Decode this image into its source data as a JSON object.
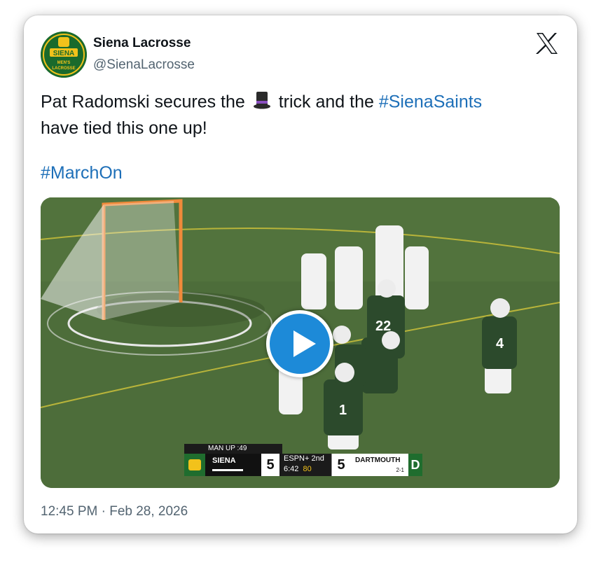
{
  "author": {
    "name": "Siena Lacrosse",
    "handle": "@SienaLacrosse",
    "avatar_text": "SIENA MEN'S LACROSSE"
  },
  "platform_icon": "x-logo-icon",
  "tweet": {
    "text_part1": "Pat Radomski secures the",
    "emoji": "top-hat-icon",
    "text_part2": "trick and the",
    "hashtag1": "#SienaSaints",
    "text_part3": "have tied this one up!",
    "hashtag2": "#MarchOn"
  },
  "media": {
    "type": "video",
    "play_icon": "play-icon",
    "scorebug": {
      "man_up": "MAN UP  :49",
      "home_team": "SIENA",
      "home_score": "5",
      "network": "ESPN+",
      "period": "2nd",
      "clock": "6:42",
      "shot_clock": "80",
      "away_score": "5",
      "away_team": "DARTMOUTH",
      "away_record": "2-1",
      "away_logo": "D"
    }
  },
  "timestamp": "12:45 PM · Feb 28, 2026",
  "colors": {
    "link": "#1d6fb8",
    "play_button": "#1d8ad8",
    "siena_green": "#1f6d2e",
    "siena_gold": "#f2c21b"
  }
}
